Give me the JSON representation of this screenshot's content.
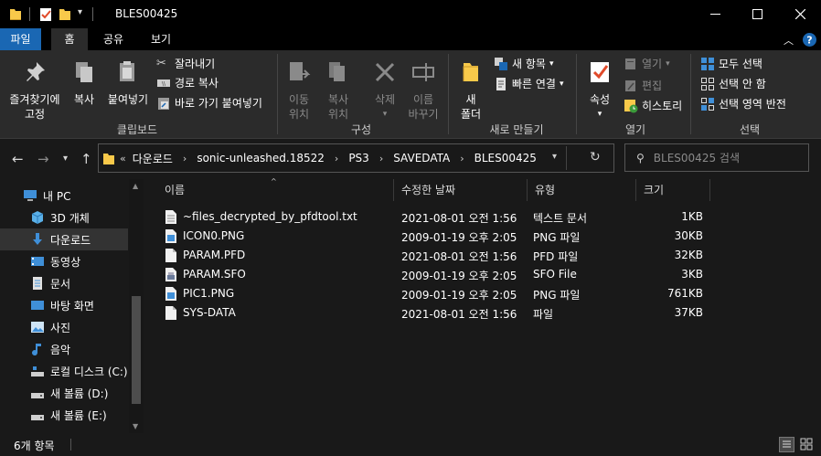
{
  "window": {
    "title": "BLES00425"
  },
  "tabs": [
    {
      "label": "파일"
    },
    {
      "label": "홈"
    },
    {
      "label": "공유"
    },
    {
      "label": "보기"
    }
  ],
  "ribbon": {
    "clipboard": {
      "pin": "즐겨찾기에\n고정",
      "copy": "복사",
      "paste": "붙여넣기",
      "cut": "잘라내기",
      "copy_path": "경로 복사",
      "paste_shortcut": "바로 가기 붙여넣기",
      "label": "클립보드"
    },
    "organize": {
      "move_to": "이동\n위치",
      "copy_to": "복사\n위치",
      "delete": "삭제",
      "rename": "이름\n바꾸기",
      "label": "구성"
    },
    "new": {
      "new_folder": "새\n폴더",
      "new_item": "새 항목",
      "easy_access": "빠른 연결",
      "label": "새로 만들기"
    },
    "open": {
      "properties": "속성",
      "open": "열기",
      "edit": "편집",
      "history": "히스토리",
      "label": "열기"
    },
    "select": {
      "select_all": "모두 선택",
      "select_none": "선택 안 함",
      "invert": "선택 영역 반전",
      "label": "선택"
    }
  },
  "breadcrumb": [
    "다운로드",
    "sonic-unleashed.18522",
    "PS3",
    "SAVEDATA",
    "BLES00425"
  ],
  "breadcrumb_overflow": "«",
  "search": {
    "placeholder": "BLES00425 검색"
  },
  "nav": [
    {
      "label": "내 PC",
      "icon": "pc-icon"
    },
    {
      "label": "3D 개체",
      "icon": "cube-icon"
    },
    {
      "label": "다운로드",
      "icon": "download-arrow-icon",
      "selected": true
    },
    {
      "label": "동영상",
      "icon": "video-icon"
    },
    {
      "label": "문서",
      "icon": "document-icon"
    },
    {
      "label": "바탕 화면",
      "icon": "desktop-icon"
    },
    {
      "label": "사진",
      "icon": "picture-icon"
    },
    {
      "label": "음악",
      "icon": "music-icon"
    },
    {
      "label": "로컬 디스크 (C:)",
      "icon": "system-drive-icon"
    },
    {
      "label": "새 볼륨 (D:)",
      "icon": "drive-icon"
    },
    {
      "label": "새 볼륨 (E:)",
      "icon": "drive-icon"
    }
  ],
  "columns": {
    "name": "이름",
    "modified": "수정한 날짜",
    "type": "유형",
    "size": "크기"
  },
  "files": [
    {
      "name": "~files_decrypted_by_pfdtool.txt",
      "modified": "2021-08-01 오전 1:56",
      "type": "텍스트 문서",
      "size": "1KB",
      "icon": "text-file-icon"
    },
    {
      "name": "ICON0.PNG",
      "modified": "2009-01-19 오후 2:05",
      "type": "PNG 파일",
      "size": "30KB",
      "icon": "png-file-icon"
    },
    {
      "name": "PARAM.PFD",
      "modified": "2021-08-01 오전 1:56",
      "type": "PFD 파일",
      "size": "32KB",
      "icon": "file-icon"
    },
    {
      "name": "PARAM.SFO",
      "modified": "2009-01-19 오후 2:05",
      "type": "SFO File",
      "size": "3KB",
      "icon": "sfo-file-icon"
    },
    {
      "name": "PIC1.PNG",
      "modified": "2009-01-19 오후 2:05",
      "type": "PNG 파일",
      "size": "761KB",
      "icon": "png-file-icon"
    },
    {
      "name": "SYS-DATA",
      "modified": "2021-08-01 오전 1:56",
      "type": "파일",
      "size": "37KB",
      "icon": "file-icon"
    }
  ],
  "status": {
    "item_count": "6개 항목"
  },
  "colors": {
    "accent": "#1a67b3",
    "background": "#191919",
    "ribbon": "#2b2b2b",
    "folder": "#f8c94a"
  }
}
